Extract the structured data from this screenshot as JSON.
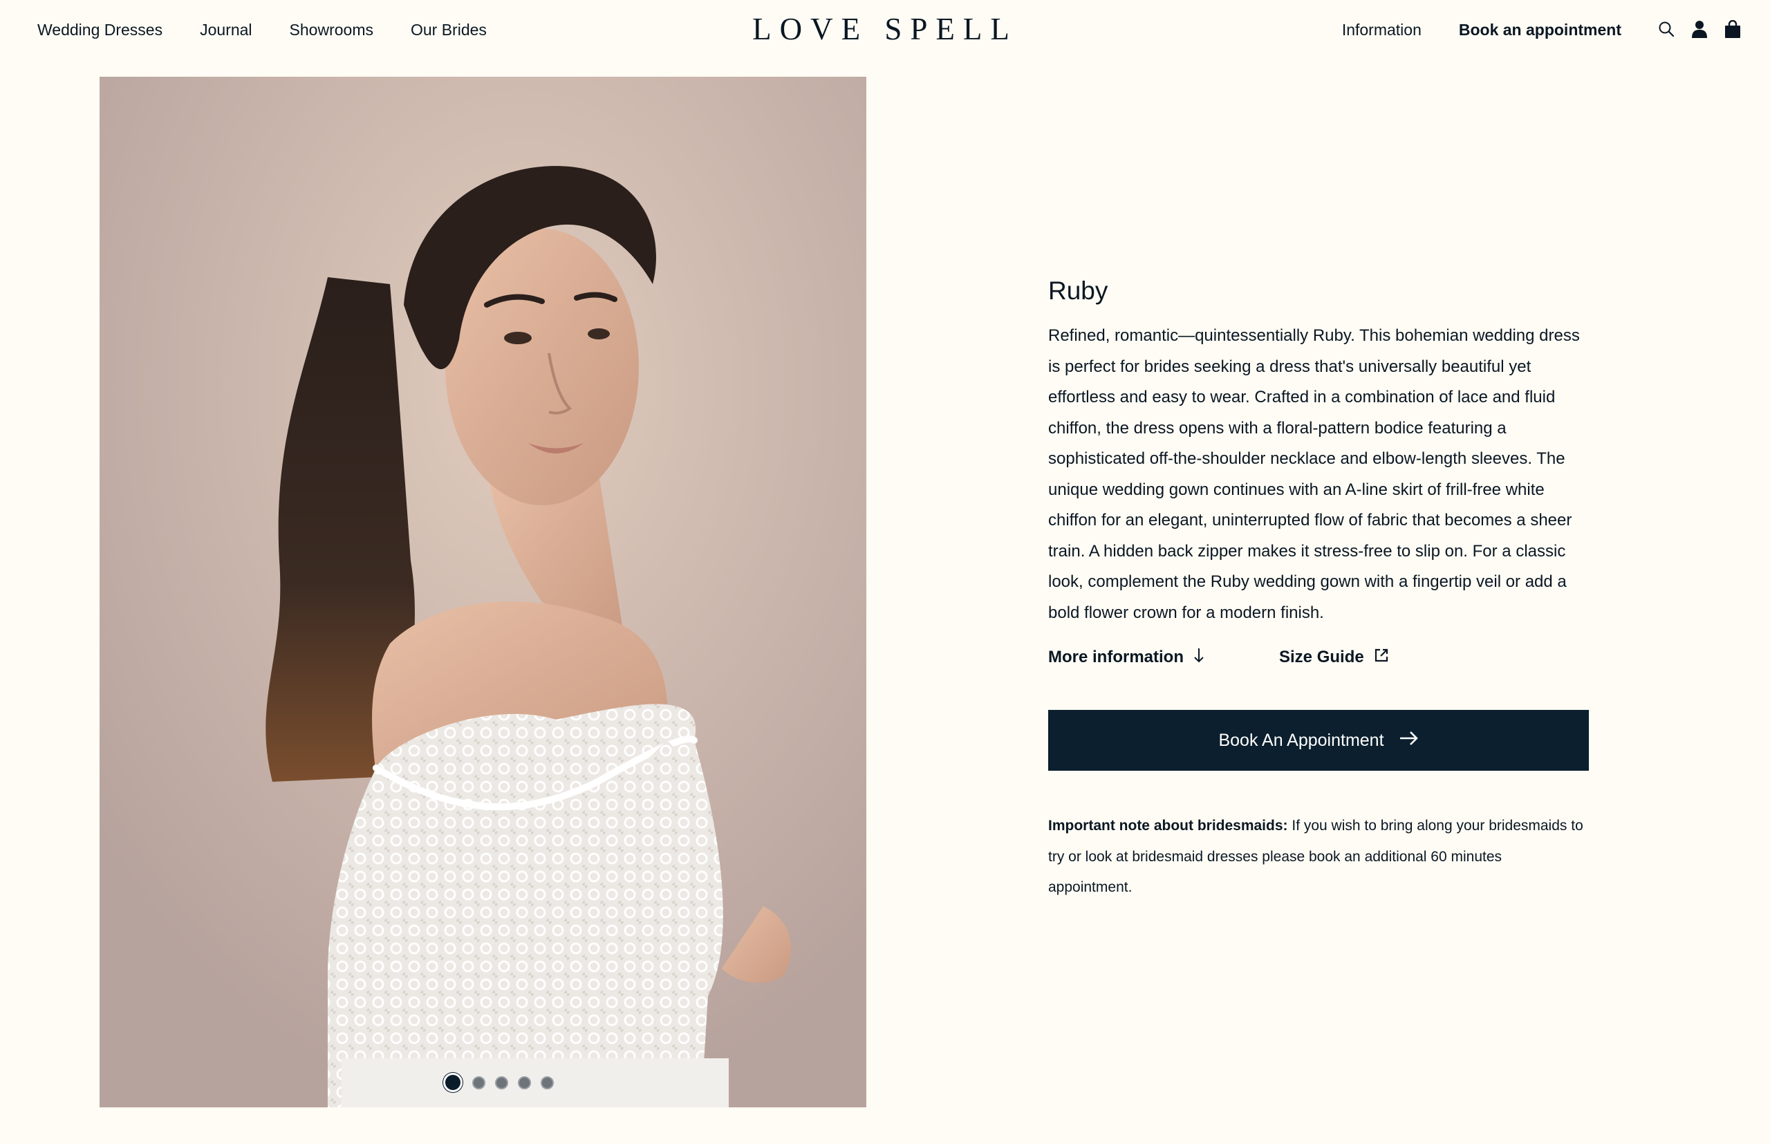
{
  "header": {
    "nav_left": [
      {
        "label": "Wedding Dresses"
      },
      {
        "label": "Journal"
      },
      {
        "label": "Showrooms"
      },
      {
        "label": "Our Brides"
      }
    ],
    "logo": "LOVE SPELL",
    "nav_right": {
      "information": "Information",
      "book": "Book an appointment"
    },
    "icons": [
      "search-icon",
      "user-icon",
      "bag-icon"
    ]
  },
  "gallery": {
    "image_count": 5,
    "active_index": 0
  },
  "product": {
    "title": "Ruby",
    "description": "Refined, romantic—quintessentially Ruby. This bohemian wedding dress is perfect for brides seeking a dress that's universally beautiful yet effortless and easy to wear. Crafted in a combination of lace and fluid chiffon, the dress opens with a floral-pattern bodice featuring a sophisticated off-the-shoulder necklace and elbow-length sleeves. The unique wedding gown continues with an A-line skirt of frill-free white chiffon for an elegant, uninterrupted flow of fabric that becomes a sheer train. A hidden back zipper makes it stress-free to slip on. For a classic look, complement the Ruby wedding gown with a fingertip veil or add a bold flower crown for a modern finish.",
    "more_information": "More information",
    "size_guide": "Size Guide",
    "cta_label": "Book An Appointment",
    "note_label": "Important note about bridesmaids:",
    "note_text": " If you wish to bring along your bridesmaids to try or look at bridesmaid dresses please book an additional 60 minutes appointment."
  },
  "colors": {
    "background": "#fffcf5",
    "navy": "#0b1f2e",
    "text": "#0a1722"
  }
}
